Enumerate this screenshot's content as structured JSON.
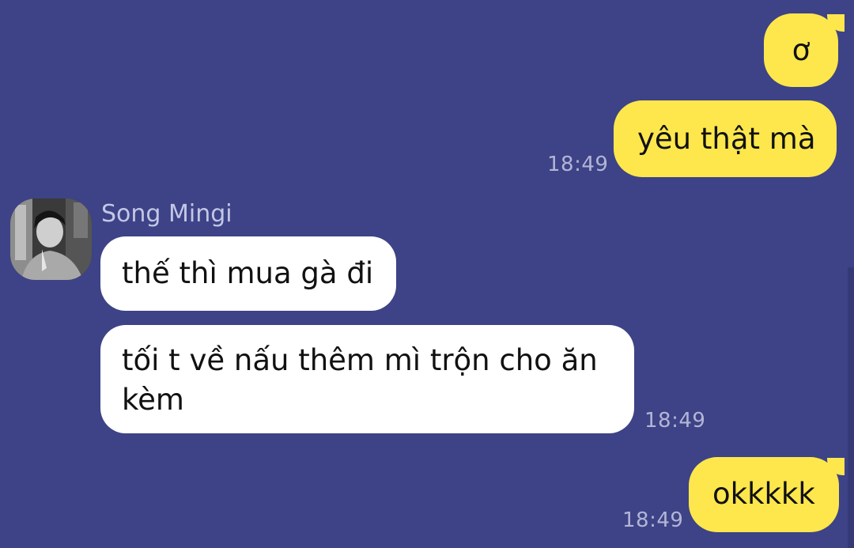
{
  "chat": {
    "messages": [
      {
        "id": "m1",
        "direction": "outgoing",
        "text": "ơ",
        "time": ""
      },
      {
        "id": "m2",
        "direction": "outgoing",
        "text": "yêu thật mà",
        "time": "18:49"
      },
      {
        "id": "m3",
        "direction": "incoming",
        "sender": "Song Mingi",
        "text": "thế thì mua gà đi",
        "time": ""
      },
      {
        "id": "m4",
        "direction": "incoming",
        "text_line1": "tối t về nấu thêm mì trộn cho ăn",
        "text_line2": "kèm",
        "time": "18:49"
      },
      {
        "id": "m5",
        "direction": "outgoing",
        "text": "okkkkk",
        "time": "18:49"
      }
    ],
    "avatar_icon": "user-avatar-photo"
  },
  "colors": {
    "background": "#3d4386",
    "outgoing_bubble": "#fde74c",
    "incoming_bubble": "#ffffff",
    "timestamp": "#b3b5d6",
    "sender_name": "#c4c6e6"
  }
}
